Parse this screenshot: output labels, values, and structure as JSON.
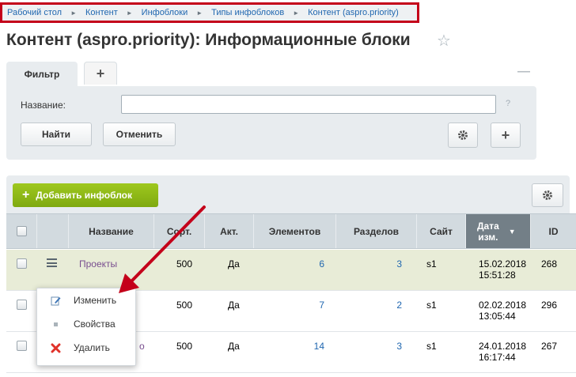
{
  "breadcrumb": [
    "Рабочий стол",
    "Контент",
    "Инфоблоки",
    "Типы инфоблоков",
    "Контент (aspro.priority)"
  ],
  "page_title": "Контент (aspro.priority): Информационные блоки",
  "filter": {
    "tab_label": "Фильтр",
    "add_tab": "+",
    "name_label": "Название:",
    "name_value": "",
    "help": "?",
    "find_button": "Найти",
    "cancel_button": "Отменить",
    "add_button": "+"
  },
  "toolbar": {
    "add_infoblock": "Добавить инфоблок"
  },
  "table": {
    "headers": {
      "name": "Название",
      "sort": "Сорт.",
      "active": "Акт.",
      "elements": "Элементов",
      "sections": "Разделов",
      "site": "Сайт",
      "date1": "Дата",
      "date2": "изм.",
      "id": "ID"
    },
    "rows": [
      {
        "name": "Проекты",
        "sort": "500",
        "active": "Да",
        "elements": "6",
        "sections": "3",
        "site": "s1",
        "date": "15.02.2018",
        "time": "15:51:28",
        "id": "268"
      },
      {
        "name": "",
        "sort": "500",
        "active": "Да",
        "elements": "7",
        "sections": "2",
        "site": "s1",
        "date": "02.02.2018",
        "time": "13:05:44",
        "id": "296"
      },
      {
        "name": "о",
        "sort": "500",
        "active": "Да",
        "elements": "14",
        "sections": "3",
        "site": "s1",
        "date": "24.01.2018",
        "time": "16:17:44",
        "id": "267"
      }
    ]
  },
  "context_menu": {
    "edit": "Изменить",
    "properties": "Свойства",
    "delete": "Удалить"
  },
  "colors": {
    "accent_green": "#8ab81a",
    "highlight_red": "#c4001a",
    "link_blue": "#2067b0"
  }
}
